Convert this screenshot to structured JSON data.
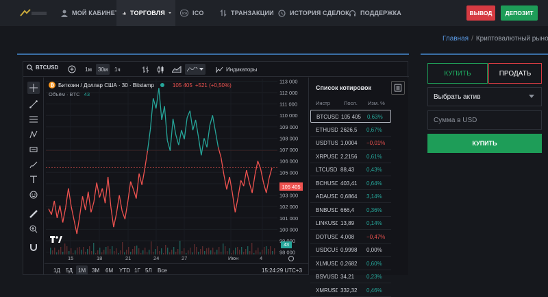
{
  "nav": {
    "items": [
      {
        "label": "МОЙ КАБИНЕТ",
        "icon": "user-icon"
      },
      {
        "label": "ТОРГОВЛЯ",
        "icon": "chart-icon"
      },
      {
        "label": "ICO",
        "icon": "ico-icon"
      },
      {
        "label": "ТРАНЗАКЦИИ",
        "icon": "transfer-icon"
      },
      {
        "label": "ИСТОРИЯ СДЕЛОК",
        "icon": "history-icon"
      },
      {
        "label": "ПОДДЕРЖКА",
        "icon": "headset-icon"
      }
    ],
    "withdraw_label": "ВЫВОД",
    "deposit_label": "ДЕПОЗИТ"
  },
  "breadcrumb": {
    "home": "Главная",
    "separator": "/",
    "current": "Криптовалютный рынок"
  },
  "toolbar": {
    "symbol": "BTCUSD",
    "intervals": [
      "1м",
      "30м",
      "1ч"
    ],
    "active_interval": "30м",
    "indicators_label": "Индикаторы"
  },
  "chart_legend": {
    "title": "Биткоин / Доллар США · 30 · Bitstamp",
    "price": "105 405",
    "change": "+521 (+0,50%)",
    "volume_label": "Объём · BTC",
    "volume_value": "43"
  },
  "chart_data": {
    "type": "line",
    "yaxis_ticks": [
      "113 000",
      "112 000",
      "111 000",
      "110 000",
      "109 000",
      "108 000",
      "107 000",
      "106 000",
      "105 000",
      "104 000",
      "103 000",
      "102 000",
      "101 000",
      "100 000",
      "99 000",
      "98 000"
    ],
    "xaxis_ticks": [
      "15",
      "18",
      "21",
      "24",
      "27",
      "Июн",
      "4"
    ],
    "ylim": [
      97800,
      113200
    ],
    "last_price_label": "105 405",
    "last_volume_label": "43",
    "series": [
      {
        "values": [
          101800,
          101300,
          102500,
          101000,
          102100,
          100600,
          101900,
          103600,
          102000,
          100800,
          99600,
          101200,
          102900,
          101700,
          103300,
          101500,
          102400,
          104100,
          102800,
          103600,
          102300,
          104600,
          102000,
          100200,
          101400,
          103000,
          101600,
          100900,
          102400,
          104200,
          103500,
          102700,
          104900,
          103900,
          105300,
          106900,
          108800,
          111500,
          110600,
          112400,
          109600,
          110800,
          107800,
          106900,
          109700,
          108300,
          107400,
          108700,
          107900,
          109800,
          110400,
          108700,
          109600,
          108100,
          106500,
          108000,
          107200,
          109100,
          110000,
          108600,
          107200,
          106300,
          104800,
          103500,
          104600,
          103200,
          101500,
          102800,
          104300,
          103800,
          105200,
          104100,
          103200,
          104800,
          106000,
          105300,
          104100,
          103200,
          104500,
          105400
        ]
      }
    ]
  },
  "bottombar": {
    "ranges": [
      "1Д",
      "5Д",
      "1М",
      "3М",
      "6М",
      "YTD",
      "1Г",
      "5Л",
      "Все"
    ],
    "active_range": "1М",
    "time": "15:24:29 UTC+3"
  },
  "quotes": {
    "title": "Список котировок",
    "headers": [
      "Инстр",
      "Посл.",
      "Изм. %"
    ],
    "rows": [
      {
        "sym": "BTCUSD",
        "last": "105 405",
        "chg": "0,63%",
        "dir": "up"
      },
      {
        "sym": "ETHUSD",
        "last": "2626,5",
        "chg": "0,67%",
        "dir": "up"
      },
      {
        "sym": "USDTUSD",
        "last": "1,0004",
        "chg": "−0,01%",
        "dir": "down"
      },
      {
        "sym": "XRPUSD",
        "last": "2,2156",
        "chg": "0,61%",
        "dir": "up"
      },
      {
        "sym": "LTCUSD",
        "last": "88,43",
        "chg": "0,43%",
        "dir": "up"
      },
      {
        "sym": "BCHUSD",
        "last": "403,41",
        "chg": "0,64%",
        "dir": "up"
      },
      {
        "sym": "ADAUSD",
        "last": "0,6864",
        "chg": "3,14%",
        "dir": "up"
      },
      {
        "sym": "BNBUSD",
        "last": "666,4",
        "chg": "0,36%",
        "dir": "up"
      },
      {
        "sym": "LINKUSD",
        "last": "13,89",
        "chg": "0,14%",
        "dir": "up"
      },
      {
        "sym": "DOTUSD",
        "last": "4,008",
        "chg": "−0,47%",
        "dir": "down"
      },
      {
        "sym": "USDCUSD",
        "last": "0,9998",
        "chg": "0,00%",
        "dir": "neu"
      },
      {
        "sym": "XLMUSD",
        "last": "0,2682",
        "chg": "0,60%",
        "dir": "up"
      },
      {
        "sym": "BSVUSD",
        "last": "34,21",
        "chg": "0,23%",
        "dir": "up"
      },
      {
        "sym": "XMRUSD",
        "last": "332,32",
        "chg": "0,46%",
        "dir": "up"
      }
    ]
  },
  "order": {
    "buy_tab": "КУПИТЬ",
    "sell_tab": "ПРОДАТЬ",
    "asset_select": "Выбрать актив",
    "amount_placeholder": "Сумма в USD",
    "buy_button": "КУПИТЬ"
  },
  "colors": {
    "up": "#26a69a",
    "down": "#ef5350",
    "accent": "#1e9d58",
    "danger": "#d63b42"
  }
}
